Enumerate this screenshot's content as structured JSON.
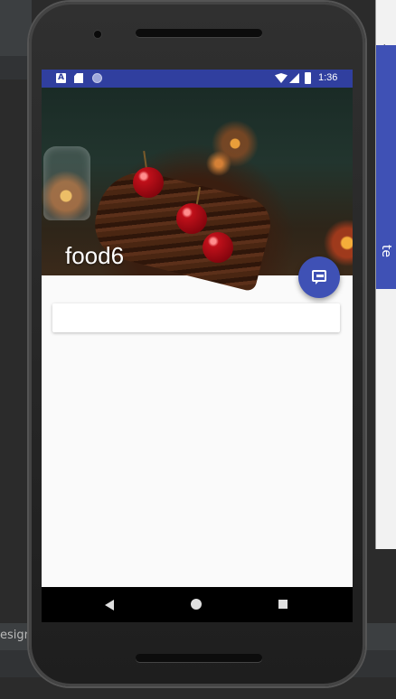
{
  "ide": {
    "bottom_tab_label": "esign",
    "right_panel_vertical_text": "te"
  },
  "status_bar": {
    "time": "1:36",
    "notification_icons": [
      "a-badge-icon",
      "sd-card-icon",
      "sync-circle-icon"
    ],
    "system_icons": [
      "wifi-icon",
      "signal-icon",
      "battery-icon"
    ],
    "color": "#303f9f"
  },
  "header": {
    "title": "food6",
    "image": "food-photo-cherry-chocolate-log"
  },
  "fab": {
    "icon": "chat-icon",
    "color": "#3f51b5"
  },
  "card": {
    "text": ""
  },
  "nav_bar": {
    "buttons": [
      "back-icon",
      "home-icon",
      "recents-icon"
    ]
  },
  "colors": {
    "primary": "#3f51b5",
    "primary_dark": "#303f9f",
    "background": "#fafafa"
  }
}
